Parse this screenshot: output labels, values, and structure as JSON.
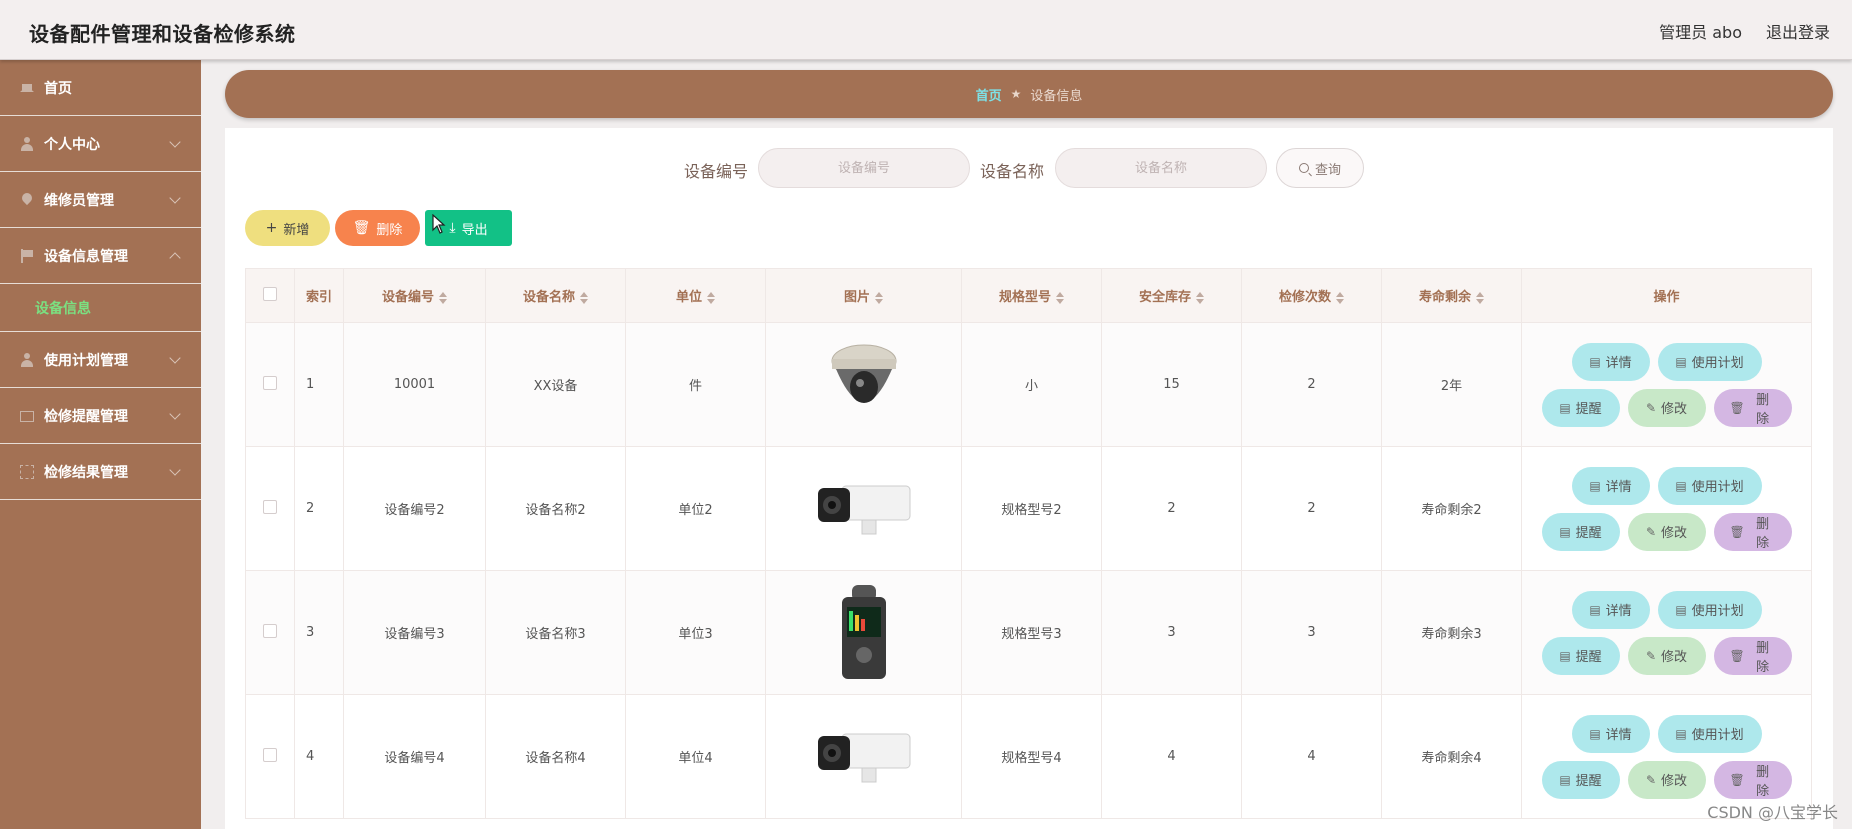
{
  "header": {
    "app_title": "设备配件管理和设备检修系统",
    "admin_label": "管理员 abo",
    "logout_label": "退出登录"
  },
  "sidebar": {
    "items": [
      {
        "label": "首页",
        "icon": "home-icon"
      },
      {
        "label": "个人中心",
        "icon": "user-icon"
      },
      {
        "label": "维修员管理",
        "icon": "location-pin-icon"
      },
      {
        "label": "设备信息管理",
        "icon": "flag-icon"
      },
      {
        "label": "使用计划管理",
        "icon": "user-icon"
      },
      {
        "label": "检修提醒管理",
        "icon": "mail-icon"
      },
      {
        "label": "检修结果管理",
        "icon": "frame-icon"
      }
    ],
    "active_sub": "设备信息",
    "active_sub_color": "#7be081"
  },
  "breadcrumb": {
    "home": "首页",
    "separator": "★",
    "current": "设备信息"
  },
  "search": {
    "code_label": "设备编号",
    "code_placeholder": "设备编号",
    "name_label": "设备名称",
    "name_placeholder": "设备名称",
    "query_label": "查询"
  },
  "actions": {
    "add_label": "新增",
    "delete_label": "删除",
    "export_label": "导出"
  },
  "table": {
    "headers": [
      "索引",
      "设备编号",
      "设备名称",
      "单位",
      "图片",
      "规格型号",
      "安全库存",
      "检修次数",
      "寿命剩余",
      "操作"
    ],
    "rows": [
      {
        "index": "1",
        "code": "10001",
        "name": "XX设备",
        "unit": "件",
        "image": "dome-camera",
        "spec": "小",
        "stock": "15",
        "repairs": "2",
        "life": "2年"
      },
      {
        "index": "2",
        "code": "设备编号2",
        "name": "设备名称2",
        "unit": "单位2",
        "image": "bullet-camera",
        "spec": "规格型号2",
        "stock": "2",
        "repairs": "2",
        "life": "寿命剩余2"
      },
      {
        "index": "3",
        "code": "设备编号3",
        "name": "设备名称3",
        "unit": "单位3",
        "image": "handheld-recorder",
        "spec": "规格型号3",
        "stock": "3",
        "repairs": "3",
        "life": "寿命剩余3"
      },
      {
        "index": "4",
        "code": "设备编号4",
        "name": "设备名称4",
        "unit": "单位4",
        "image": "bullet-camera",
        "spec": "规格型号4",
        "stock": "4",
        "repairs": "4",
        "life": "寿命剩余4"
      }
    ],
    "row_actions": {
      "detail": "详情",
      "plan": "使用计划",
      "remind": "提醒",
      "edit": "修改",
      "delete": "删除"
    }
  },
  "watermark": "CSDN @八宝学长",
  "colors": {
    "sidebar_bg": "#a37154",
    "header_bg": "#f3efef",
    "add_btn": "#efdf7f",
    "delete_btn": "#f7834d",
    "export_btn": "#12c186",
    "cyan_btn": "#aee8ec",
    "green_btn": "#c8e8c8",
    "purple_btn": "#d4b7e3"
  }
}
